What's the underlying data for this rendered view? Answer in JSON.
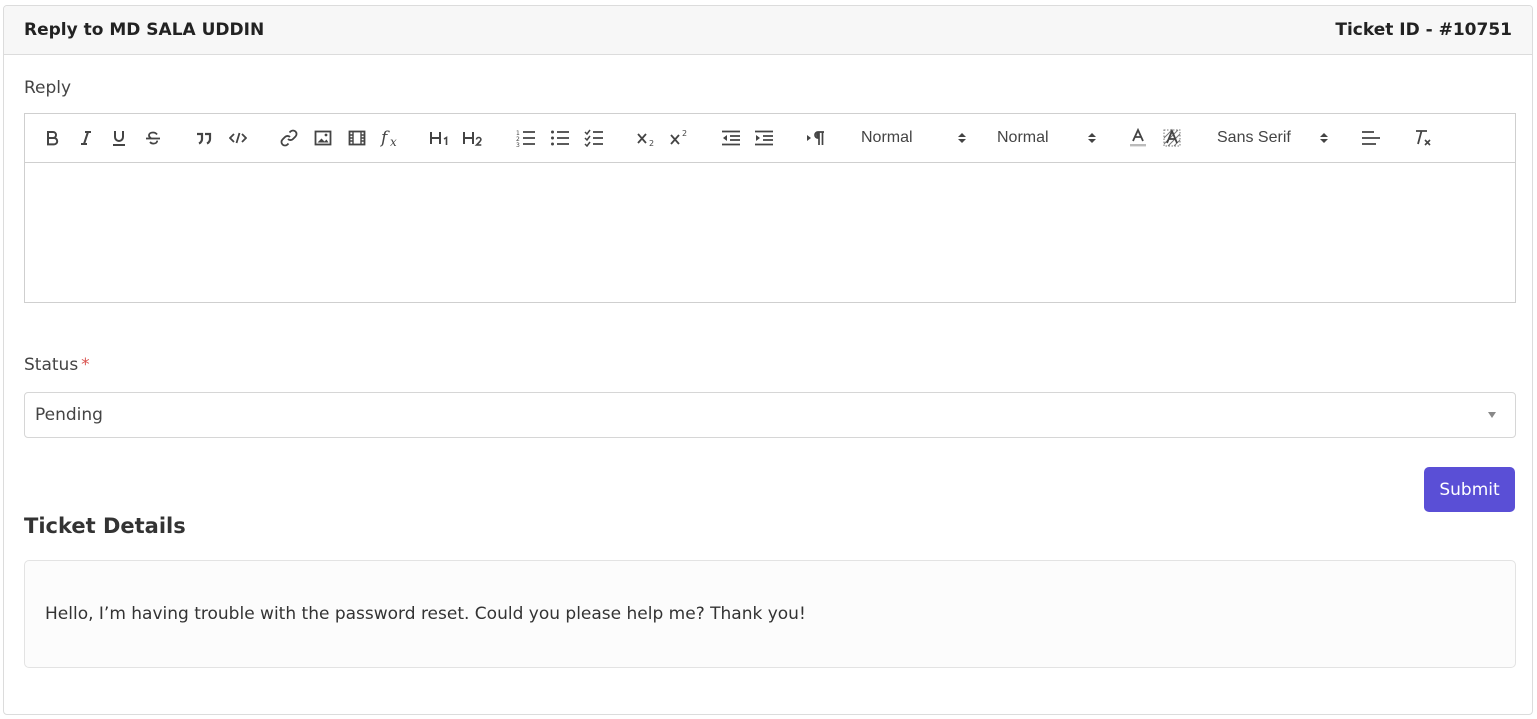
{
  "header": {
    "title": "Reply to MD SALA UDDIN",
    "ticket_id": "Ticket ID - #10751"
  },
  "reply": {
    "label": "Reply",
    "toolbar": {
      "header_picker": "Normal",
      "size_picker": "Normal",
      "font_picker": "Sans Serif"
    },
    "body": ""
  },
  "status": {
    "label": "Status",
    "required_mark": "*",
    "selected": "Pending"
  },
  "submit_label": "Submit",
  "details": {
    "title": "Ticket Details",
    "message": "Hello, I’m having trouble with the password reset. Could you please help me? Thank you!"
  },
  "colors": {
    "primary": "#5a4fd6",
    "required": "#d9534f",
    "header_bg": "#f7f7f7"
  }
}
